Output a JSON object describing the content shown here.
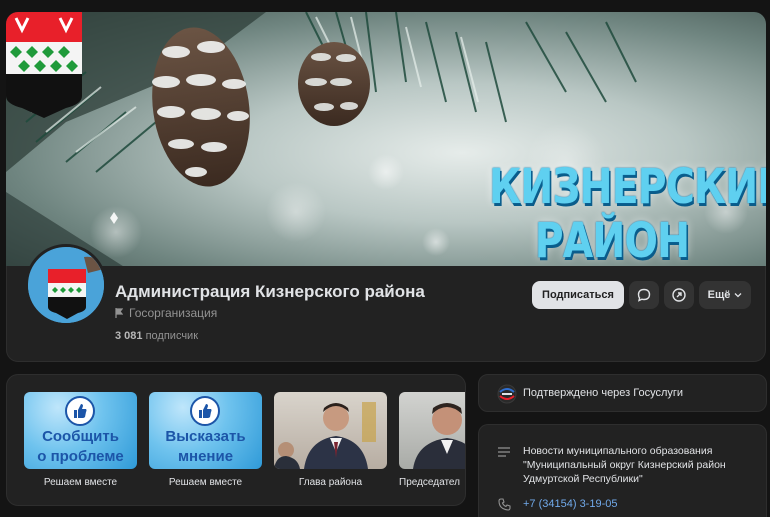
{
  "cover": {
    "title_line1": "КИЗНЕРСКИЙ",
    "title_line2": "РАЙОН"
  },
  "group": {
    "name": "Администрация Кизнерского района",
    "type": "Госорганизация",
    "subscribers_count": "3 081",
    "subscribers_label": "подписчик"
  },
  "actions": {
    "subscribe_label": "Подписаться",
    "message_icon": "message-icon",
    "share_icon": "share-icon",
    "more_label": "Ещё"
  },
  "services": [
    {
      "image_text_line1": "Сообщить",
      "image_text_line2": "о проблеме",
      "caption": "Решаем вместе"
    },
    {
      "image_text_line1": "Высказать",
      "image_text_line2": "мнение",
      "caption": "Решаем вместе"
    },
    {
      "caption": "Глава района"
    },
    {
      "caption": "Председател"
    }
  ],
  "verified": {
    "icon": "gosuslugi-icon",
    "text": "Подтверждено через Госуслуги"
  },
  "info": {
    "description": "Новости муниципального образования \"Муниципальный округ Кизнерский район Удмуртской Республики\"",
    "phone": "+7 (34154) 3-19-05"
  },
  "colors": {
    "background": "#141414",
    "card": "#222222",
    "link": "#71aaeb",
    "cover_title": "#5fd0f0",
    "coat_red": "#e8202a",
    "coat_green": "#1f9a3a"
  }
}
